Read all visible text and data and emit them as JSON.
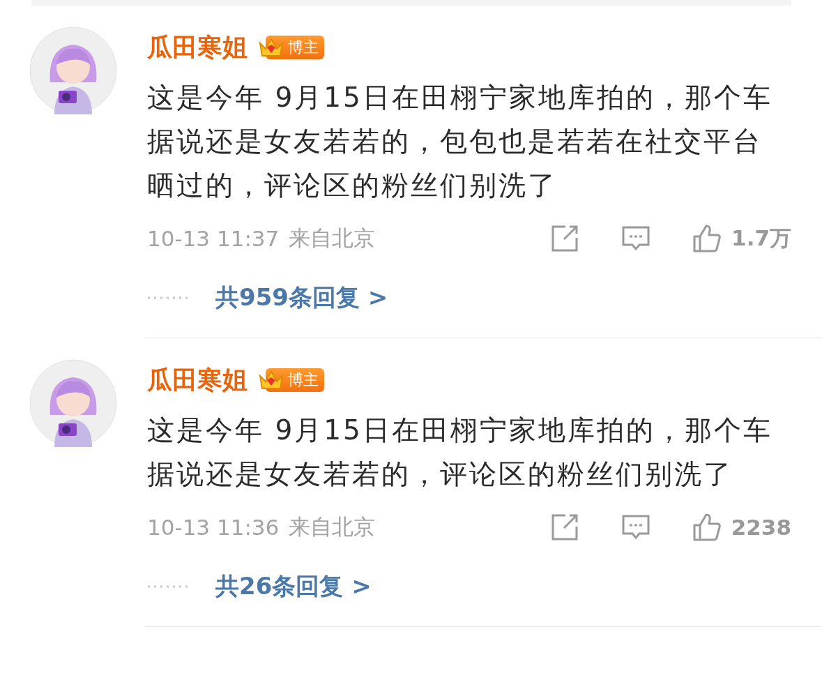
{
  "comments": [
    {
      "author": "瓜田寒姐",
      "badge": "博主",
      "text": "这是今年 9月15日在田栩宁家地库拍的，那个车据说还是女友若若的，包包也是若若在社交平台晒过的，评论区的粉丝们别洗了",
      "time": "10-13 11:37",
      "location": "来自北京",
      "likes": "1.7万",
      "replies": "共959条回复 >"
    },
    {
      "author": "瓜田寒姐",
      "badge": "博主",
      "text": "这是今年 9月15日在田栩宁家地库拍的，那个车据说还是女友若若的，评论区的粉丝们别洗了",
      "time": "10-13 11:36",
      "location": "来自北京",
      "likes": "2238",
      "replies": "共26条回复 >"
    }
  ]
}
